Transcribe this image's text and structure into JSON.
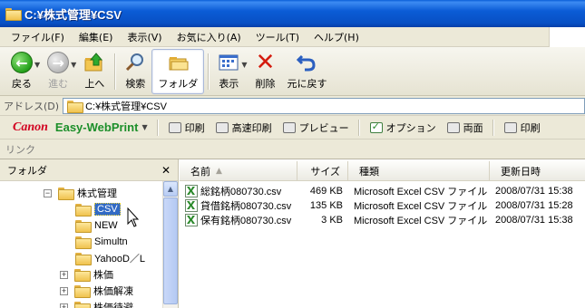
{
  "window": {
    "title": "C:¥株式管理¥CSV"
  },
  "menu": [
    "ファイル(F)",
    "編集(E)",
    "表示(V)",
    "お気に入り(A)",
    "ツール(T)",
    "ヘルプ(H)"
  ],
  "toolbar": {
    "back": "戻る",
    "forward": "進む",
    "up": "上へ",
    "search": "検索",
    "folders": "フォルダ",
    "views": "表示",
    "delete": "削除",
    "undo": "元に戻す"
  },
  "address": {
    "label": "アドレス(D)",
    "value": "C:¥株式管理¥CSV"
  },
  "canon_bar": {
    "brand": "Canon",
    "product": "Easy-WebPrint",
    "print": "印刷",
    "fast_print": "高速印刷",
    "preview": "プレビュー",
    "options": "オプション",
    "duplex": "両面",
    "print_more": "印刷"
  },
  "links_bar": {
    "label": "リンク"
  },
  "folder_pane": {
    "title": "フォルダ",
    "nodes": [
      "株式管理",
      "CSV",
      "NEW",
      "Simultn",
      "YahooD／L",
      "株価",
      "株価解凍",
      "株価待避"
    ]
  },
  "file_list": {
    "headers": {
      "name": "名前",
      "size": "サイズ",
      "type": "種類",
      "date": "更新日時"
    },
    "rows": [
      {
        "name": "総銘柄080730.csv",
        "size": "469 KB",
        "type": "Microsoft Excel CSV ファイル",
        "date": "2008/07/31 15:38"
      },
      {
        "name": "貸借銘柄080730.csv",
        "size": "135 KB",
        "type": "Microsoft Excel CSV ファイル",
        "date": "2008/07/31 15:28"
      },
      {
        "name": "保有銘柄080730.csv",
        "size": "3 KB",
        "type": "Microsoft Excel CSV ファイル",
        "date": "2008/07/31 15:38"
      }
    ]
  }
}
